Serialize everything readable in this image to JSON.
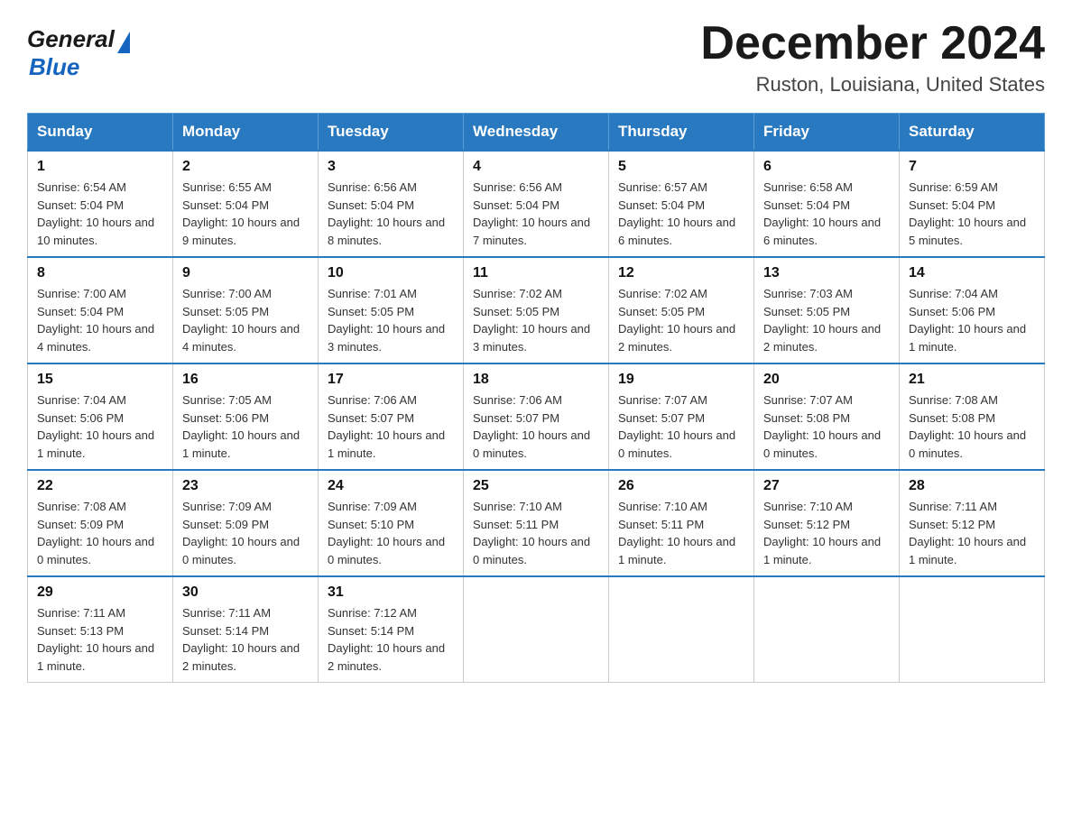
{
  "header": {
    "logo_general": "General",
    "logo_blue": "Blue",
    "month_year": "December 2024",
    "location": "Ruston, Louisiana, United States"
  },
  "days_of_week": [
    "Sunday",
    "Monday",
    "Tuesday",
    "Wednesday",
    "Thursday",
    "Friday",
    "Saturday"
  ],
  "weeks": [
    [
      {
        "day": "1",
        "sunrise": "6:54 AM",
        "sunset": "5:04 PM",
        "daylight": "10 hours and 10 minutes."
      },
      {
        "day": "2",
        "sunrise": "6:55 AM",
        "sunset": "5:04 PM",
        "daylight": "10 hours and 9 minutes."
      },
      {
        "day": "3",
        "sunrise": "6:56 AM",
        "sunset": "5:04 PM",
        "daylight": "10 hours and 8 minutes."
      },
      {
        "day": "4",
        "sunrise": "6:56 AM",
        "sunset": "5:04 PM",
        "daylight": "10 hours and 7 minutes."
      },
      {
        "day": "5",
        "sunrise": "6:57 AM",
        "sunset": "5:04 PM",
        "daylight": "10 hours and 6 minutes."
      },
      {
        "day": "6",
        "sunrise": "6:58 AM",
        "sunset": "5:04 PM",
        "daylight": "10 hours and 6 minutes."
      },
      {
        "day": "7",
        "sunrise": "6:59 AM",
        "sunset": "5:04 PM",
        "daylight": "10 hours and 5 minutes."
      }
    ],
    [
      {
        "day": "8",
        "sunrise": "7:00 AM",
        "sunset": "5:04 PM",
        "daylight": "10 hours and 4 minutes."
      },
      {
        "day": "9",
        "sunrise": "7:00 AM",
        "sunset": "5:05 PM",
        "daylight": "10 hours and 4 minutes."
      },
      {
        "day": "10",
        "sunrise": "7:01 AM",
        "sunset": "5:05 PM",
        "daylight": "10 hours and 3 minutes."
      },
      {
        "day": "11",
        "sunrise": "7:02 AM",
        "sunset": "5:05 PM",
        "daylight": "10 hours and 3 minutes."
      },
      {
        "day": "12",
        "sunrise": "7:02 AM",
        "sunset": "5:05 PM",
        "daylight": "10 hours and 2 minutes."
      },
      {
        "day": "13",
        "sunrise": "7:03 AM",
        "sunset": "5:05 PM",
        "daylight": "10 hours and 2 minutes."
      },
      {
        "day": "14",
        "sunrise": "7:04 AM",
        "sunset": "5:06 PM",
        "daylight": "10 hours and 1 minute."
      }
    ],
    [
      {
        "day": "15",
        "sunrise": "7:04 AM",
        "sunset": "5:06 PM",
        "daylight": "10 hours and 1 minute."
      },
      {
        "day": "16",
        "sunrise": "7:05 AM",
        "sunset": "5:06 PM",
        "daylight": "10 hours and 1 minute."
      },
      {
        "day": "17",
        "sunrise": "7:06 AM",
        "sunset": "5:07 PM",
        "daylight": "10 hours and 1 minute."
      },
      {
        "day": "18",
        "sunrise": "7:06 AM",
        "sunset": "5:07 PM",
        "daylight": "10 hours and 0 minutes."
      },
      {
        "day": "19",
        "sunrise": "7:07 AM",
        "sunset": "5:07 PM",
        "daylight": "10 hours and 0 minutes."
      },
      {
        "day": "20",
        "sunrise": "7:07 AM",
        "sunset": "5:08 PM",
        "daylight": "10 hours and 0 minutes."
      },
      {
        "day": "21",
        "sunrise": "7:08 AM",
        "sunset": "5:08 PM",
        "daylight": "10 hours and 0 minutes."
      }
    ],
    [
      {
        "day": "22",
        "sunrise": "7:08 AM",
        "sunset": "5:09 PM",
        "daylight": "10 hours and 0 minutes."
      },
      {
        "day": "23",
        "sunrise": "7:09 AM",
        "sunset": "5:09 PM",
        "daylight": "10 hours and 0 minutes."
      },
      {
        "day": "24",
        "sunrise": "7:09 AM",
        "sunset": "5:10 PM",
        "daylight": "10 hours and 0 minutes."
      },
      {
        "day": "25",
        "sunrise": "7:10 AM",
        "sunset": "5:11 PM",
        "daylight": "10 hours and 0 minutes."
      },
      {
        "day": "26",
        "sunrise": "7:10 AM",
        "sunset": "5:11 PM",
        "daylight": "10 hours and 1 minute."
      },
      {
        "day": "27",
        "sunrise": "7:10 AM",
        "sunset": "5:12 PM",
        "daylight": "10 hours and 1 minute."
      },
      {
        "day": "28",
        "sunrise": "7:11 AM",
        "sunset": "5:12 PM",
        "daylight": "10 hours and 1 minute."
      }
    ],
    [
      {
        "day": "29",
        "sunrise": "7:11 AM",
        "sunset": "5:13 PM",
        "daylight": "10 hours and 1 minute."
      },
      {
        "day": "30",
        "sunrise": "7:11 AM",
        "sunset": "5:14 PM",
        "daylight": "10 hours and 2 minutes."
      },
      {
        "day": "31",
        "sunrise": "7:12 AM",
        "sunset": "5:14 PM",
        "daylight": "10 hours and 2 minutes."
      },
      null,
      null,
      null,
      null
    ]
  ],
  "labels": {
    "sunrise_prefix": "Sunrise: ",
    "sunset_prefix": "Sunset: ",
    "daylight_prefix": "Daylight: "
  }
}
